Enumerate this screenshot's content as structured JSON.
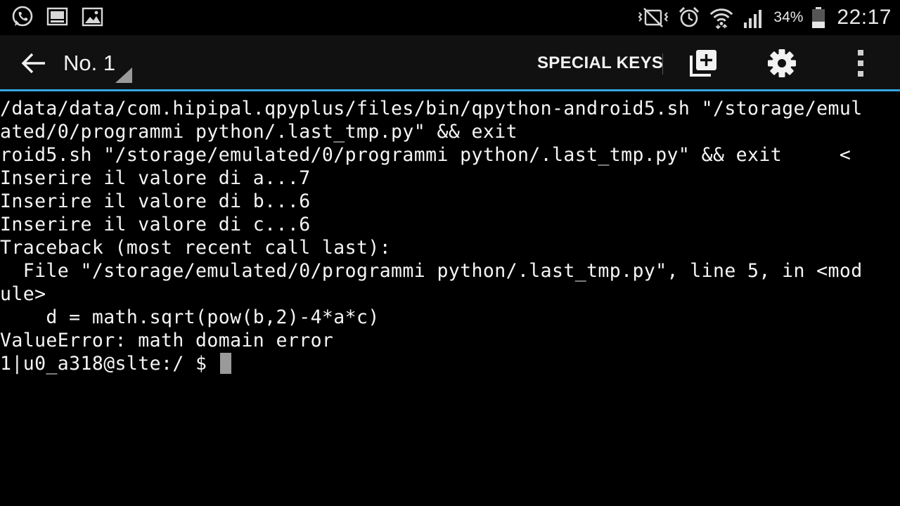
{
  "status_bar": {
    "left_icons": [
      "whatsapp-icon",
      "screen-icon",
      "gallery-icon"
    ],
    "right_icons": [
      "vibrate-mute-icon",
      "alarm-icon",
      "wifi-icon",
      "signal-icon",
      "battery-icon"
    ],
    "battery_percent": "34%",
    "battery_level": 0.34,
    "time": "22:17"
  },
  "action_bar": {
    "session_title": "No. 1",
    "special_keys_label": "SPECIAL KEYS",
    "accent_color": "#33a8e0"
  },
  "terminal": {
    "lines": [
      "/data/data/com.hipipal.qpyplus/files/bin/qpython-android5.sh \"/storage/emul",
      "ated/0/programmi python/.last_tmp.py\" && exit",
      "roid5.sh \"/storage/emulated/0/programmi python/.last_tmp.py\" && exit     <",
      "Inserire il valore di a...7",
      "Inserire il valore di b...6",
      "Inserire il valore di c...6",
      "Traceback (most recent call last):",
      "  File \"/storage/emulated/0/programmi python/.last_tmp.py\", line 5, in <mod",
      "ule>",
      "    d = math.sqrt(pow(b,2)-4*a*c)",
      "ValueError: math domain error"
    ],
    "prompt": "1|u0_a318@slte:/ $ "
  }
}
